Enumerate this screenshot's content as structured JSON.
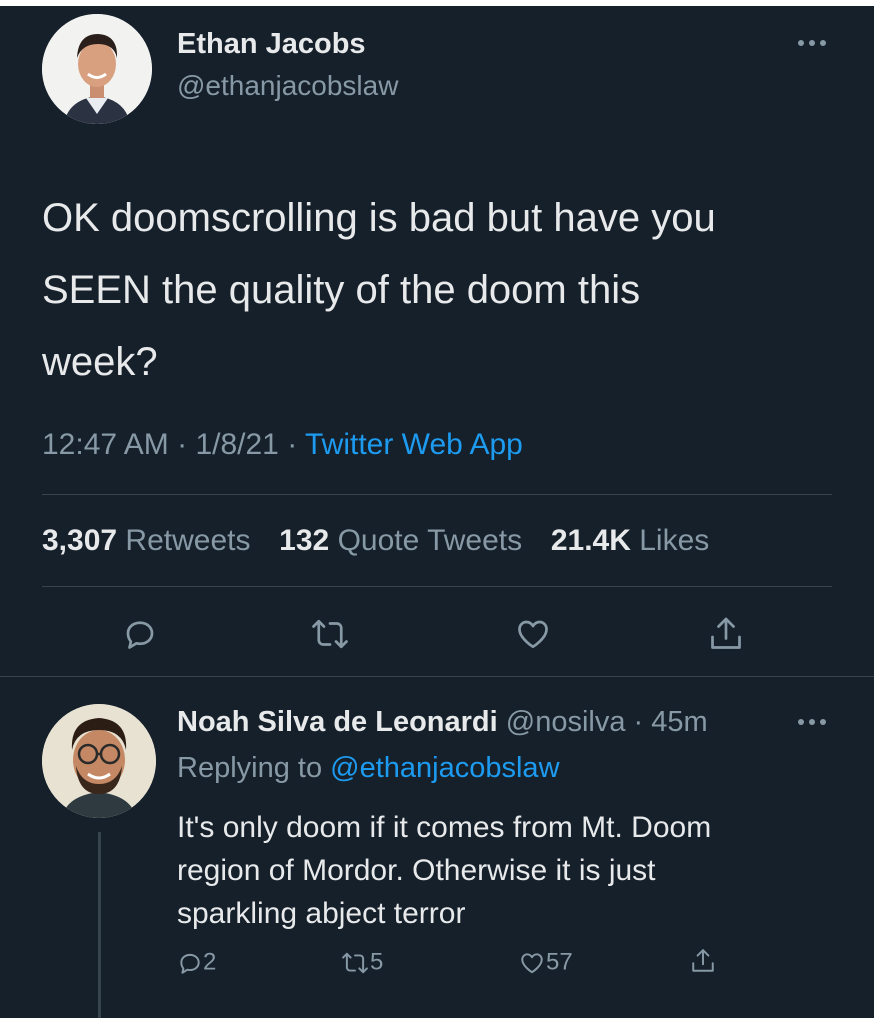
{
  "colors": {
    "background": "#15202b",
    "text": "#e7e9ea",
    "muted": "#8899a6",
    "link": "#1d9bf0",
    "divider": "#38444d"
  },
  "tweet": {
    "author_name": "Ethan Jacobs",
    "author_handle": "@ethanjacobslaw",
    "text_lines": [
      "OK doomscrolling is bad but have you",
      "SEEN the quality of the doom this",
      "week?"
    ],
    "time": "12:47 AM",
    "sep1": " · ",
    "date": "1/8/21",
    "sep2": " · ",
    "source": "Twitter Web App",
    "stats": {
      "retweets_count": "3,307",
      "retweets_label": "Retweets",
      "quotes_count": "132",
      "quotes_label": "Quote Tweets",
      "likes_count": "21.4K",
      "likes_label": "Likes"
    },
    "actions": [
      "reply-icon",
      "retweet-icon",
      "like-icon",
      "share-icon"
    ]
  },
  "reply": {
    "author_name": "Noah Silva de Leonardi",
    "author_handle": "@nosilva",
    "sep": " · ",
    "age": "45m",
    "replying_label": "Replying to",
    "replying_handle": "@ethanjacobslaw",
    "text_lines": [
      "It's only doom if it comes from Mt. Doom",
      "region of Mordor. Otherwise it is just",
      "sparkling abject terror"
    ],
    "reply_count": "2",
    "retweet_count": "5",
    "like_count": "57"
  }
}
